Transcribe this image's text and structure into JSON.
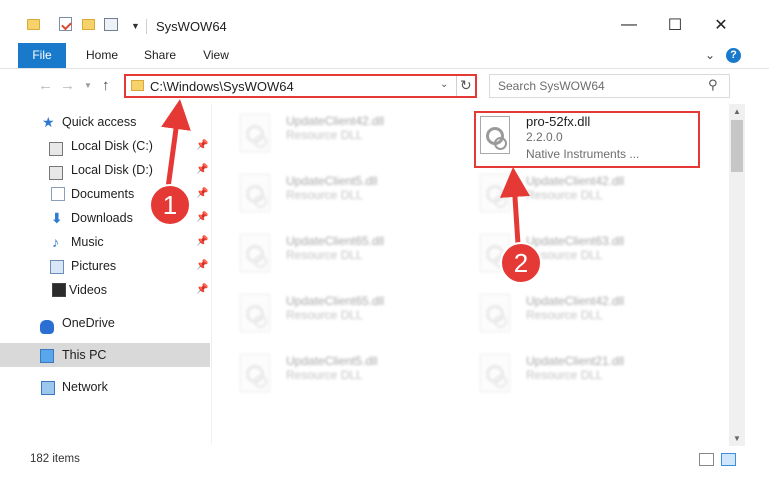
{
  "window": {
    "title": "SysWOW64",
    "minimize_glyph": "—",
    "maximize_glyph": "☐",
    "close_glyph": "✕"
  },
  "ribbon": {
    "tabs": [
      {
        "label": "File"
      },
      {
        "label": "Home"
      },
      {
        "label": "Share"
      },
      {
        "label": "View"
      }
    ],
    "collapse_glyph": "⌄",
    "help_glyph": "?"
  },
  "navigation": {
    "back_glyph": "←",
    "forward_glyph": "→",
    "recent_glyph": "▼",
    "up_glyph": "↑",
    "address_path": "C:\\Windows\\SysWOW64",
    "address_dropdown_glyph": "⌄",
    "refresh_glyph": "↻",
    "search_placeholder": "Search SysWOW64",
    "search_glyph": "⚲"
  },
  "sidebar": {
    "quick_access": {
      "label": "Quick access",
      "icon": "star-icon"
    },
    "pinned": [
      {
        "label": "Local Disk (C:)",
        "icon": "disk-icon"
      },
      {
        "label": "Local Disk (D:)",
        "icon": "disk-icon"
      },
      {
        "label": "Documents",
        "icon": "documents-icon"
      },
      {
        "label": "Downloads",
        "icon": "downloads-icon"
      },
      {
        "label": "Music",
        "icon": "music-icon"
      },
      {
        "label": "Pictures",
        "icon": "pictures-icon"
      },
      {
        "label": "Videos",
        "icon": "videos-icon"
      }
    ],
    "pin_glyph": "📌",
    "onedrive": {
      "label": "OneDrive",
      "icon": "cloud-icon"
    },
    "this_pc": {
      "label": "This PC",
      "icon": "computer-icon"
    },
    "network": {
      "label": "Network",
      "icon": "network-icon"
    }
  },
  "files": {
    "highlighted": {
      "name": "pro-52fx.dll",
      "version": "2.2.0.0",
      "company": "Native Instruments ..."
    },
    "left_column": [
      {
        "name": "UpdateClient42.dll",
        "type": "Resource DLL"
      },
      {
        "name": "UpdateClient5.dll",
        "type": "Resource DLL"
      },
      {
        "name": "UpdateClient65.dll",
        "type": "Resource DLL"
      },
      {
        "name": "UpdateClient65.dll",
        "type": "Resource DLL"
      },
      {
        "name": "UpdateClient5.dll",
        "type": "Resource DLL"
      }
    ],
    "right_column": [
      {
        "name": "UpdateClient42.dll",
        "type": "Resource DLL"
      },
      {
        "name": "UpdateClient63.dll",
        "type": "Resource DLL"
      },
      {
        "name": "UpdateClient42.dll",
        "type": "Resource DLL"
      },
      {
        "name": "UpdateClient21.dll",
        "type": "Resource DLL"
      }
    ]
  },
  "status": {
    "item_count": "182 items"
  },
  "annotations": {
    "badge_1": "1",
    "badge_2": "2"
  },
  "colors": {
    "accent": "#1979ca",
    "highlight_red": "#e53935",
    "selection": "#cce8ff"
  }
}
